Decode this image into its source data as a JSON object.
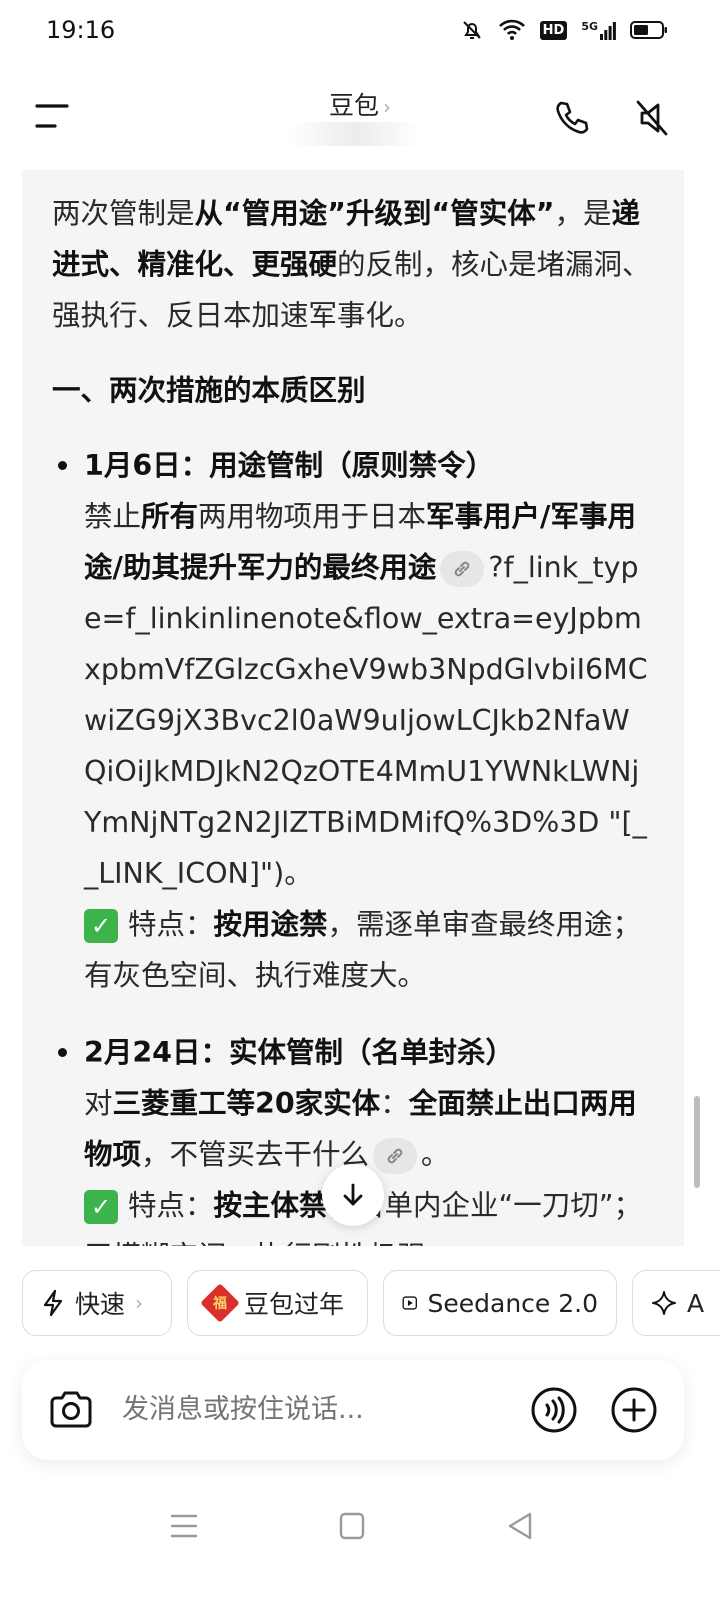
{
  "status_bar": {
    "time": "19:16",
    "network_label": "5G",
    "hd_label": "HD"
  },
  "header": {
    "title": "豆包",
    "title_chevron": "›"
  },
  "message": {
    "intro": {
      "t1": "两次管制是",
      "b1": "从“管用途”升级到“管实体”",
      "t2": "，是",
      "b2": "递进式、精准化、更强硬",
      "t3": "的反制，核心是堵漏洞、强执行、反日本加速军事化。"
    },
    "section_title": "一、两次措施的本质区别",
    "item1": {
      "title": "1月6日：用途管制（原则禁令）",
      "t1": "禁止",
      "b1": "所有",
      "t2": "两用物项用于日本",
      "b2": "军事用户/军事用途/助其提升军力的最终用途",
      "url": "?f_link_type=f_linkinlinenote&flow_extra=eyJpbmxpbmVfZGlzcGxheV9wb3NpdGlvbiI6MCwiZG9jX3Bvc2l0aW9uIjowLCJkb2NfaWQiOiJkMDJkN2QzOTE4MmU1YWNkLWNjYmNjNTg2N2JlZTBiMDMifQ%3D%3D \"[__LINK_ICON]\")。",
      "feature_label": "特点：",
      "feature_bold": "按用途禁",
      "feature_text": "，需逐单审查最终用途；有灰色空间、执行难度大。"
    },
    "item2": {
      "title": "2月24日：实体管制（名单封杀）",
      "t1": "对",
      "b1": "三菱重工等20家实体",
      "t2": "：",
      "b2": "全面禁止出口两用物项",
      "t3": "，不管买去干什么",
      "t4": "。",
      "feature_label": "特点：",
      "feature_bold": "按主体禁",
      "feature_text": "，名单内企业“一刀切”；无模糊空间、执行刚性极强。"
    }
  },
  "chips": [
    {
      "label": "快速",
      "icon": "lightning-icon",
      "chevron": "›"
    },
    {
      "label": "豆包过年",
      "icon": "fu-icon"
    },
    {
      "label": "Seedance 2.0",
      "icon": "play-icon"
    },
    {
      "label": "A",
      "icon": "sparkle-icon"
    }
  ],
  "input": {
    "placeholder": "发消息或按住说话..."
  },
  "colors": {
    "bubble_bg": "#f5f5f6",
    "check_green": "#3cb44b",
    "fu_red": "#d9302c"
  }
}
